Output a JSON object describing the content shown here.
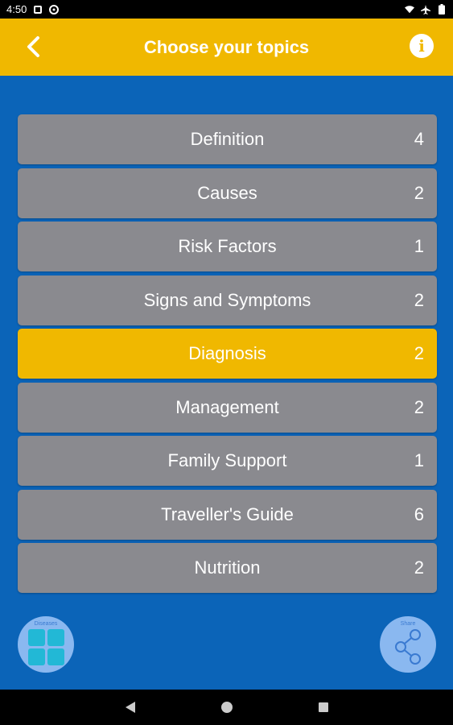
{
  "status_bar": {
    "time": "4:50",
    "icons": [
      "notification-icon",
      "sync-icon",
      "wifi-icon",
      "airplane-icon",
      "battery-icon"
    ]
  },
  "app_bar": {
    "title": "Choose your topics",
    "back_icon": "chevron-left-icon",
    "info_icon": "info-icon"
  },
  "topics": [
    {
      "label": "Definition",
      "count": "4",
      "active": false
    },
    {
      "label": "Causes",
      "count": "2",
      "active": false
    },
    {
      "label": "Risk Factors",
      "count": "1",
      "active": false
    },
    {
      "label": "Signs and Symptoms",
      "count": "2",
      "active": false
    },
    {
      "label": "Diagnosis",
      "count": "2",
      "active": true
    },
    {
      "label": "Management",
      "count": "2",
      "active": false
    },
    {
      "label": "Family Support",
      "count": "1",
      "active": false
    },
    {
      "label": "Traveller's Guide",
      "count": "6",
      "active": false
    },
    {
      "label": "Nutrition",
      "count": "2",
      "active": false
    }
  ],
  "fabs": {
    "left_label": "Diseases",
    "right_label": "Share"
  },
  "colors": {
    "background": "#0b64b8",
    "app_bar": "#f0b800",
    "topic_item": "#8a8a8f",
    "topic_active": "#f0b800"
  },
  "nav_bar": {
    "buttons": [
      "back-triangle-icon",
      "home-circle-icon",
      "recents-square-icon"
    ]
  }
}
